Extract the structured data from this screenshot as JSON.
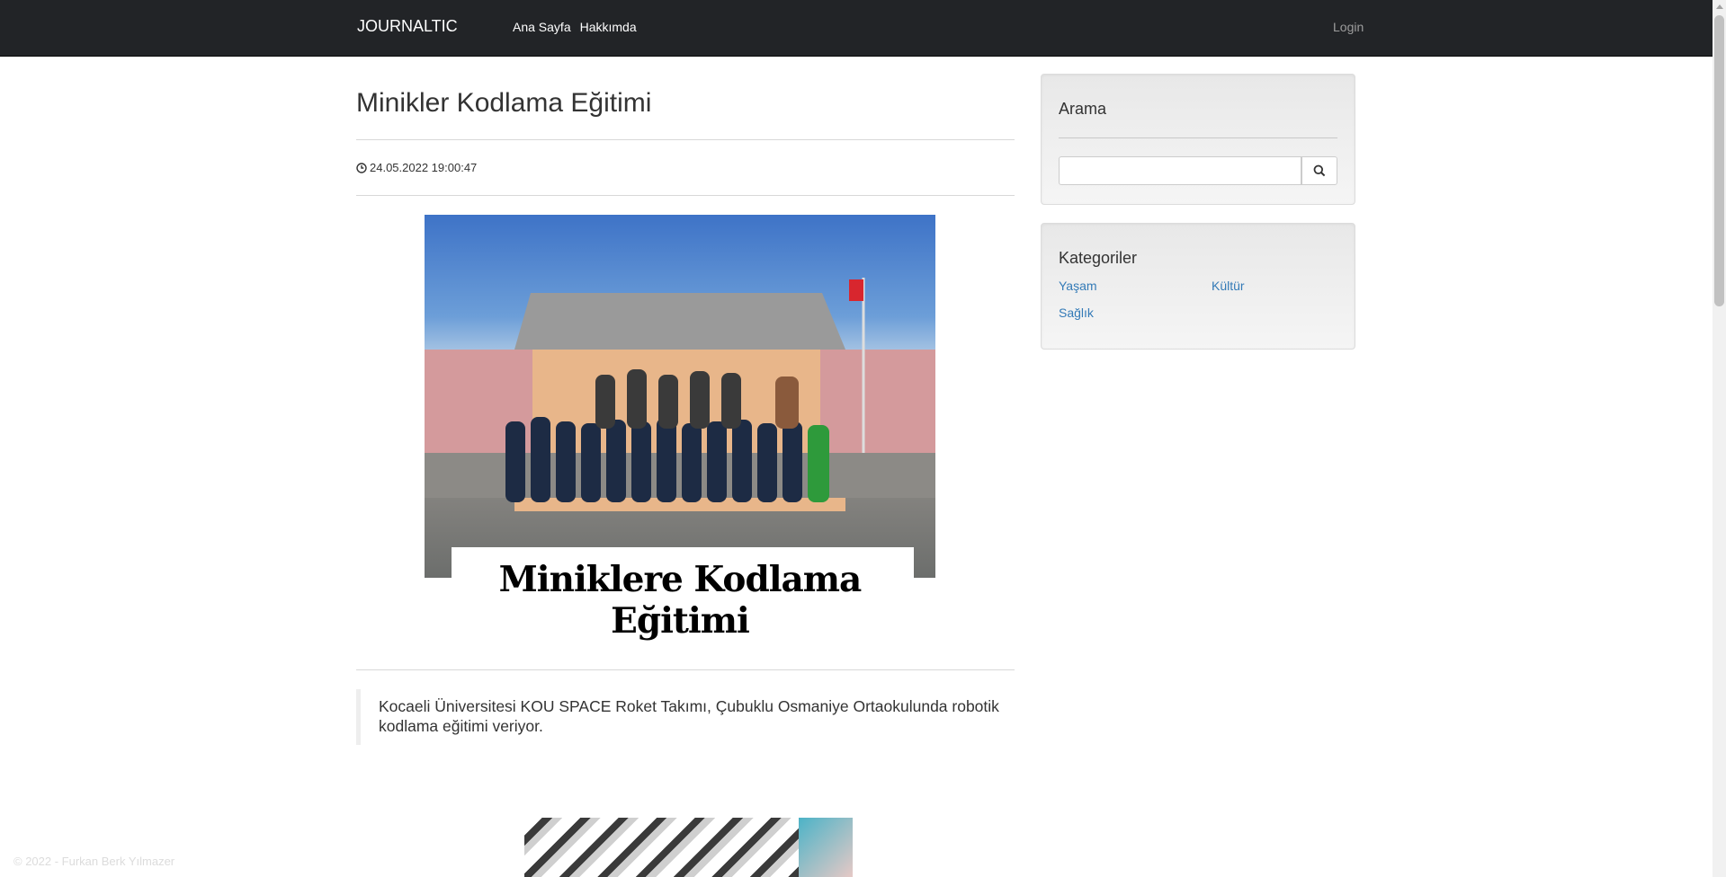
{
  "navbar": {
    "brand": "JOURNALTIC",
    "links": [
      {
        "label": "Ana Sayfa"
      },
      {
        "label": "Hakkımda"
      }
    ],
    "login_label": "Login"
  },
  "post": {
    "title": "Minikler Kodlama Eğitimi",
    "datetime": "24.05.2022 19:00:47",
    "image_caption": "Miniklere Kodlama Eğitimi",
    "quote": "Kocaeli Üniversitesi KOU SPACE Roket Takımı, Çubuklu Osmaniye Ortaokulunda robotik kodlama eğitimi veriyor."
  },
  "sidebar": {
    "search": {
      "title": "Arama",
      "value": "",
      "placeholder": ""
    },
    "categories": {
      "title": "Kategoriler",
      "items": [
        {
          "label": "Yaşam"
        },
        {
          "label": "Kültür"
        },
        {
          "label": "Sağlık"
        }
      ]
    }
  },
  "footer": {
    "text": "© 2022 - Furkan Berk Yılmazer"
  },
  "icons": {
    "clock": "clock-icon",
    "search": "search-icon"
  },
  "colors": {
    "navbar": "#222427",
    "link": "#337ab7",
    "muted": "#9d9d9d"
  }
}
